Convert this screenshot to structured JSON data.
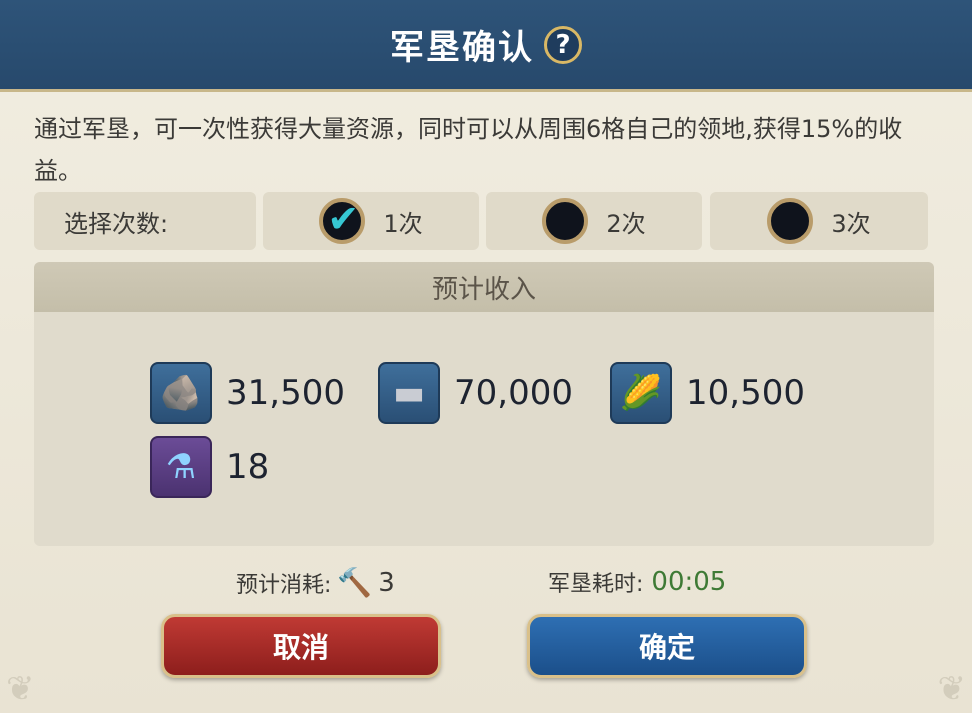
{
  "header": {
    "title": "军垦确认",
    "help_icon": "?"
  },
  "description": "通过军垦，可一次性获得大量资源，同时可以从周围6格自己的领地,获得15%的收益。",
  "selection": {
    "label": "选择次数:",
    "options": [
      {
        "label": "1次",
        "selected": true
      },
      {
        "label": "2次",
        "selected": false
      },
      {
        "label": "3次",
        "selected": false
      }
    ]
  },
  "income": {
    "title": "预计收入",
    "resources": [
      {
        "icon": "stone-icon",
        "glyph": "🪨",
        "value": "31,500"
      },
      {
        "icon": "iron-icon",
        "glyph": "▬",
        "value": "70,000"
      },
      {
        "icon": "corn-icon",
        "glyph": "🌽",
        "value": "10,500"
      },
      {
        "icon": "potion-icon",
        "glyph": "⚗",
        "value": "18"
      }
    ]
  },
  "cost": {
    "label": "预计消耗:",
    "icon": "hammer-icon",
    "value": "3"
  },
  "duration": {
    "label": "军垦耗时:",
    "value": "00:05"
  },
  "buttons": {
    "cancel": "取消",
    "confirm": "确定"
  },
  "colors": {
    "header": "#2e5479",
    "accent_check": "#36c7d3",
    "time": "#3e7a35",
    "cancel": "#c03a34",
    "confirm": "#2e6fb3"
  }
}
